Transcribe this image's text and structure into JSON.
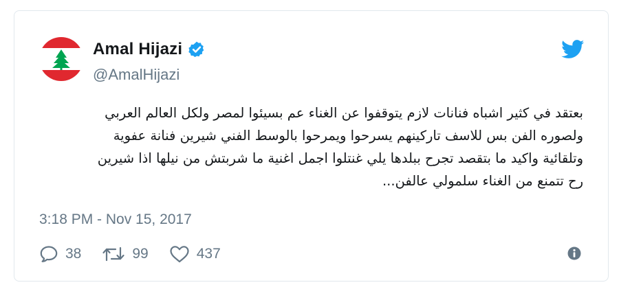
{
  "tweet": {
    "author_name": "Amal Hijazi",
    "author_handle": "@AmalHijazi",
    "text_lines": [
      "بعتقد في كثير اشباه فنانات لازم يتوقفوا عن الغناء عم بسيئوا لمصر ولكل العالم العربي",
      "ولصوره الفن بس للاسف تاركينهم يسرحوا ويمرحوا بالوسط الفني شيرين فنانة عفوية",
      "وتلقائية واكيد ما بتقصد تجرح ببلدها يلي غنتلوا اجمل اغنية ما شربتش من نيلها اذا شيرين",
      "رح تتمنع من الغناء سلمولي عالفن..."
    ],
    "timestamp": "3:18 PM - Nov 15, 2017",
    "replies": "38",
    "retweets": "99",
    "likes": "437"
  },
  "icons": {
    "verified": "verified-badge-icon",
    "bird": "twitter-bird-icon",
    "reply": "reply-icon",
    "retweet": "retweet-icon",
    "like": "heart-icon",
    "info": "info-icon"
  },
  "colors": {
    "twitter_blue": "#1da1f2",
    "muted": "#657786",
    "text": "#14171a",
    "flag_red": "#e0282f",
    "cedar_green": "#00a551"
  }
}
